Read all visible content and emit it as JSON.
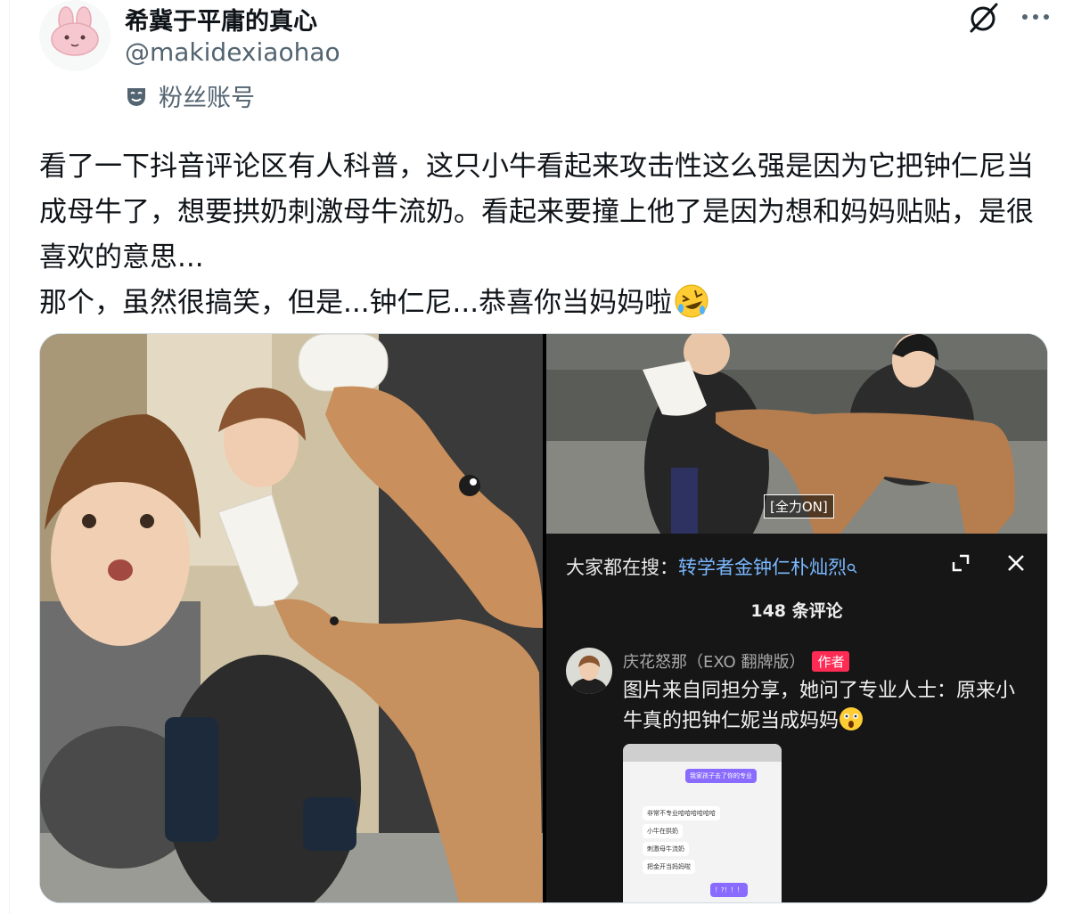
{
  "author": {
    "display_name": "希冀于平庸的真心",
    "handle": "@makidexiaohao",
    "label": "粉丝账号"
  },
  "tweet": {
    "paragraphs": [
      "看了一下抖音评论区有人科普，这只小牛看起来攻击性这么强是因为它把钟仁尼当成母牛了，想要拱奶刺激母牛流奶。看起来要撞上他了是因为想和妈妈贴贴，是很喜欢的意思...",
      "那个，虽然很搞笑，但是...钟仁尼...恭喜你当妈妈啦"
    ],
    "emoji": "rolling-on-floor-laughing"
  },
  "media": {
    "subtitle": "[全力ON]",
    "douyin": {
      "search_prefix": "大家都在搜：",
      "search_term": "转学者金钟仁朴灿烈",
      "comment_count": "148 条评论",
      "commenter_name": "庆花怒那（EXO 翻牌版）",
      "author_badge": "作者",
      "comment_text": "图片来自同担分享，她问了专业人士：原来小牛真的把钟仁妮当成妈妈",
      "chat": {
        "me_1": "我家孩子去了你的专业",
        "r_1": "非常不专业哈哈哈哈哈哈",
        "r_2": "小牛在拱奶",
        "r_3": "刺激母牛流奶",
        "r_4": "把金开当妈妈啦",
        "me_2": "！?！！！"
      }
    }
  },
  "colors": {
    "text": "#0f1419",
    "secondary": "#536471",
    "link": "#7ab8ff",
    "badge": "#fe2c55"
  }
}
